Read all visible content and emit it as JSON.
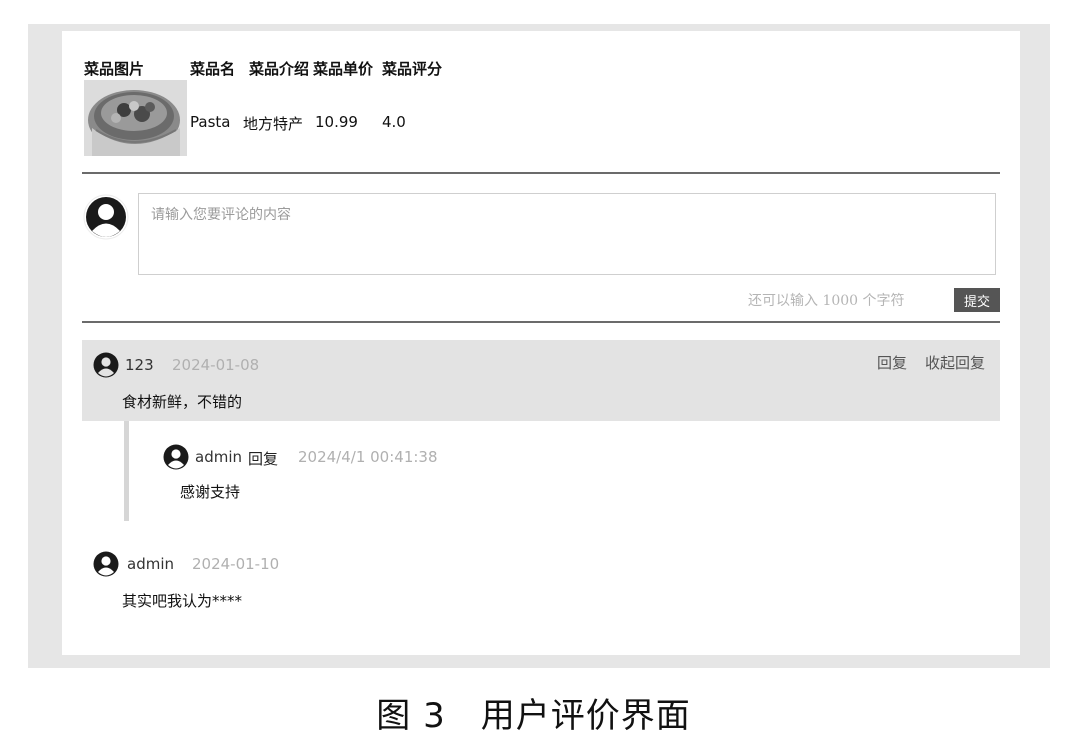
{
  "dish_table": {
    "headers": [
      "菜品图片",
      "菜品名",
      "菜品介绍",
      "菜品单价",
      "菜品评分"
    ],
    "row": {
      "name": "Pasta",
      "intro": "地方特产",
      "price": "10.99",
      "rating": "4.0"
    }
  },
  "comment_form": {
    "placeholder": "请输入您要评论的内容",
    "counter_text": "还可以输入 1000 个字符",
    "submit_label": "提交"
  },
  "comments": [
    {
      "user": "123",
      "date": "2024-01-08",
      "text": "食材新鲜，不错的",
      "actions": {
        "reply": "回复",
        "collapse": "收起回复"
      },
      "replies": [
        {
          "user": "admin",
          "reply_word": "回复",
          "date": "2024/4/1 00:41:38",
          "text": "感谢支持"
        }
      ]
    },
    {
      "user": "admin",
      "date": "2024-01-10",
      "text": "其实吧我认为****"
    }
  ],
  "caption": "图 3　用户评价界面",
  "colors": {
    "frame_bg": "#e6e6e6",
    "highlight_bg": "#e3e3e3",
    "submit_bg": "#555555",
    "muted_text": "#b0b0b0"
  },
  "icons": [
    "user-avatar-icon",
    "dish-photo"
  ]
}
